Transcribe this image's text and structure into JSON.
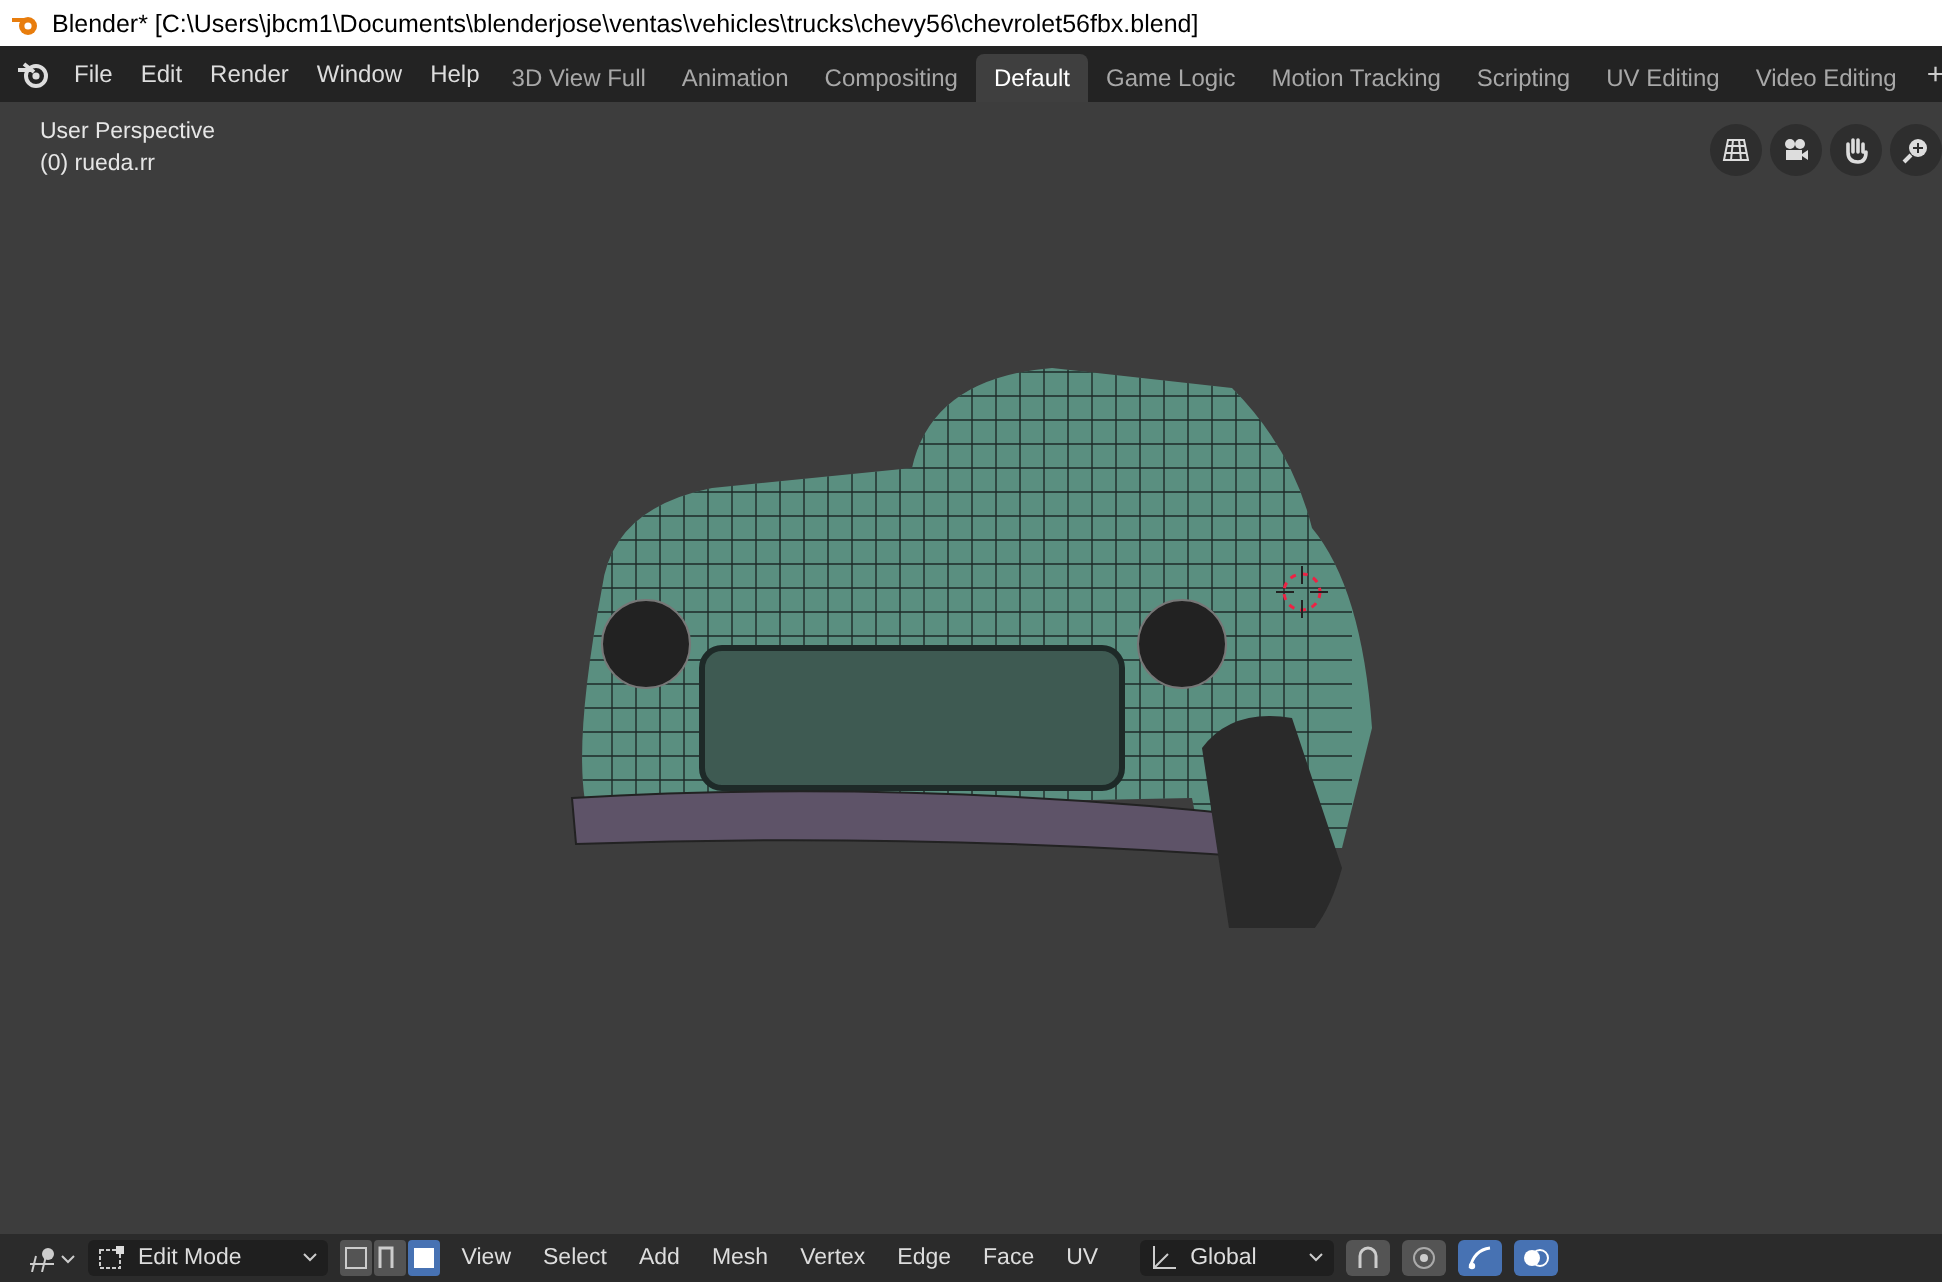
{
  "window": {
    "title": "Blender* [C:\\Users\\jbcm1\\Documents\\blenderjose\\ventas\\vehicles\\trucks\\chevy56\\chevrolet56fbx.blend]"
  },
  "menu": [
    "File",
    "Edit",
    "Render",
    "Window",
    "Help"
  ],
  "workspaces": [
    {
      "label": "3D View Full",
      "selected": false
    },
    {
      "label": "Animation",
      "selected": false
    },
    {
      "label": "Compositing",
      "selected": false
    },
    {
      "label": "Default",
      "selected": true
    },
    {
      "label": "Game Logic",
      "selected": false
    },
    {
      "label": "Motion Tracking",
      "selected": false
    },
    {
      "label": "Scripting",
      "selected": false
    },
    {
      "label": "UV Editing",
      "selected": false
    },
    {
      "label": "Video Editing",
      "selected": false
    }
  ],
  "add_workspace": "+",
  "viewport": {
    "view_name": "User Perspective",
    "object_name": "(0) rueda.rr"
  },
  "header": {
    "mode": "Edit Mode",
    "select_modes": [
      {
        "kind": "vertex",
        "selected": false
      },
      {
        "kind": "edge",
        "selected": false
      },
      {
        "kind": "face",
        "selected": true
      }
    ],
    "menus": [
      "View",
      "Select",
      "Add",
      "Mesh",
      "Vertex",
      "Edge",
      "Face",
      "UV"
    ],
    "orientation": "Global",
    "toggles": [
      {
        "kind": "snap",
        "on": false
      },
      {
        "kind": "proportional",
        "on": false
      },
      {
        "kind": "gizmo",
        "on": true
      },
      {
        "kind": "overlay",
        "on": true
      }
    ]
  }
}
